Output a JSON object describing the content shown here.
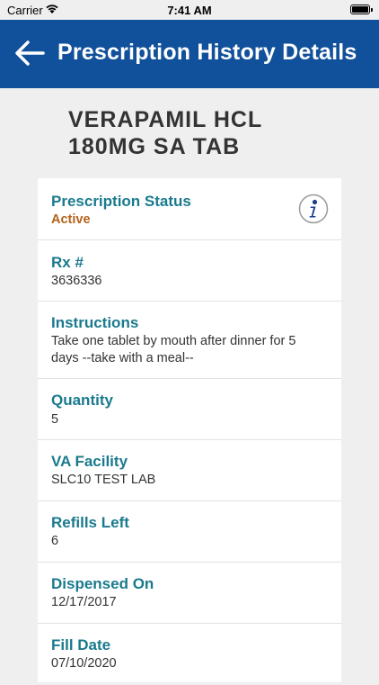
{
  "status_bar": {
    "carrier": "Carrier",
    "time": "7:41 AM"
  },
  "header": {
    "title": "Prescription History Details",
    "back_icon": "arrow-left-icon"
  },
  "prescription": {
    "name": "VERAPAMIL HCL 180MG SA TAB",
    "fields": [
      {
        "label": "Prescription Status",
        "value": "Active"
      },
      {
        "label": "Rx #",
        "value": "3636336"
      },
      {
        "label": "Instructions",
        "value": "Take one tablet by mouth after dinner for 5 days --take with a meal--"
      },
      {
        "label": "Quantity",
        "value": "5"
      },
      {
        "label": "VA Facility",
        "value": "SLC10 TEST LAB"
      },
      {
        "label": "Refills Left",
        "value": "6"
      },
      {
        "label": "Dispensed On",
        "value": "12/17/2017"
      },
      {
        "label": "Fill Date",
        "value": "07/10/2020"
      }
    ]
  },
  "colors": {
    "header_bg": "#11509a",
    "label": "#1a7a8d",
    "status_active": "#b3621a"
  }
}
